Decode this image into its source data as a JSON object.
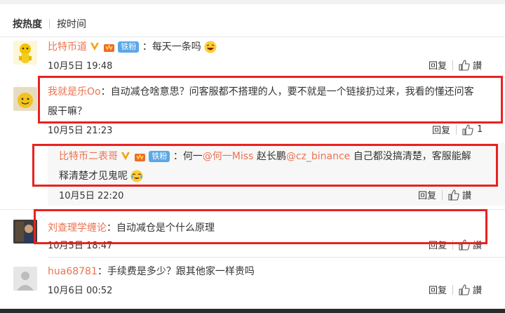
{
  "sort": {
    "hot": "按热度",
    "time": "按时间"
  },
  "actions": {
    "reply": "回复",
    "like": "讃"
  },
  "badges": {
    "fans": "铁粉"
  },
  "colors": {
    "name": "#eb7350",
    "highlight": "#e8221f",
    "fans_badge": "#5aa7e8"
  },
  "comments": [
    {
      "user": "比特币道",
      "colon": "：",
      "text": "每天一条吗",
      "emoji": "laughing-emoji",
      "time": "10月5日 19:48",
      "likes": ""
    },
    {
      "user": "我就是乐Oo",
      "colon": "：",
      "text_line1": "自动减仓啥意思？问客服都不搭理的人，要不就是一个链接扔过来，我看的懂还问客",
      "text_line2": "服干嘛？",
      "time": "10月5日 21:23",
      "likes": "1"
    },
    {
      "user": "比特币二表哥",
      "colon": "：",
      "text_a": "何一",
      "mention1": "@何一Miss",
      "text_b": " 赵长鹏",
      "mention2": "@cz_binance",
      "text_c": " 自己都没搞清楚，客服能解",
      "text_line2": "释清楚才见鬼呢",
      "emoji": "crying-laughing-emoji",
      "time": "10月5日 22:20",
      "likes": ""
    },
    {
      "user": "刘查理学缠论",
      "colon": "：",
      "text": "自动减仓是个什么原理",
      "time": "10月5日 18:47",
      "likes": ""
    },
    {
      "user": "hua68781",
      "colon": "：",
      "text": "手续费是多少？跟其他家一样贵吗",
      "time": "10月6日 00:52",
      "likes": ""
    }
  ]
}
